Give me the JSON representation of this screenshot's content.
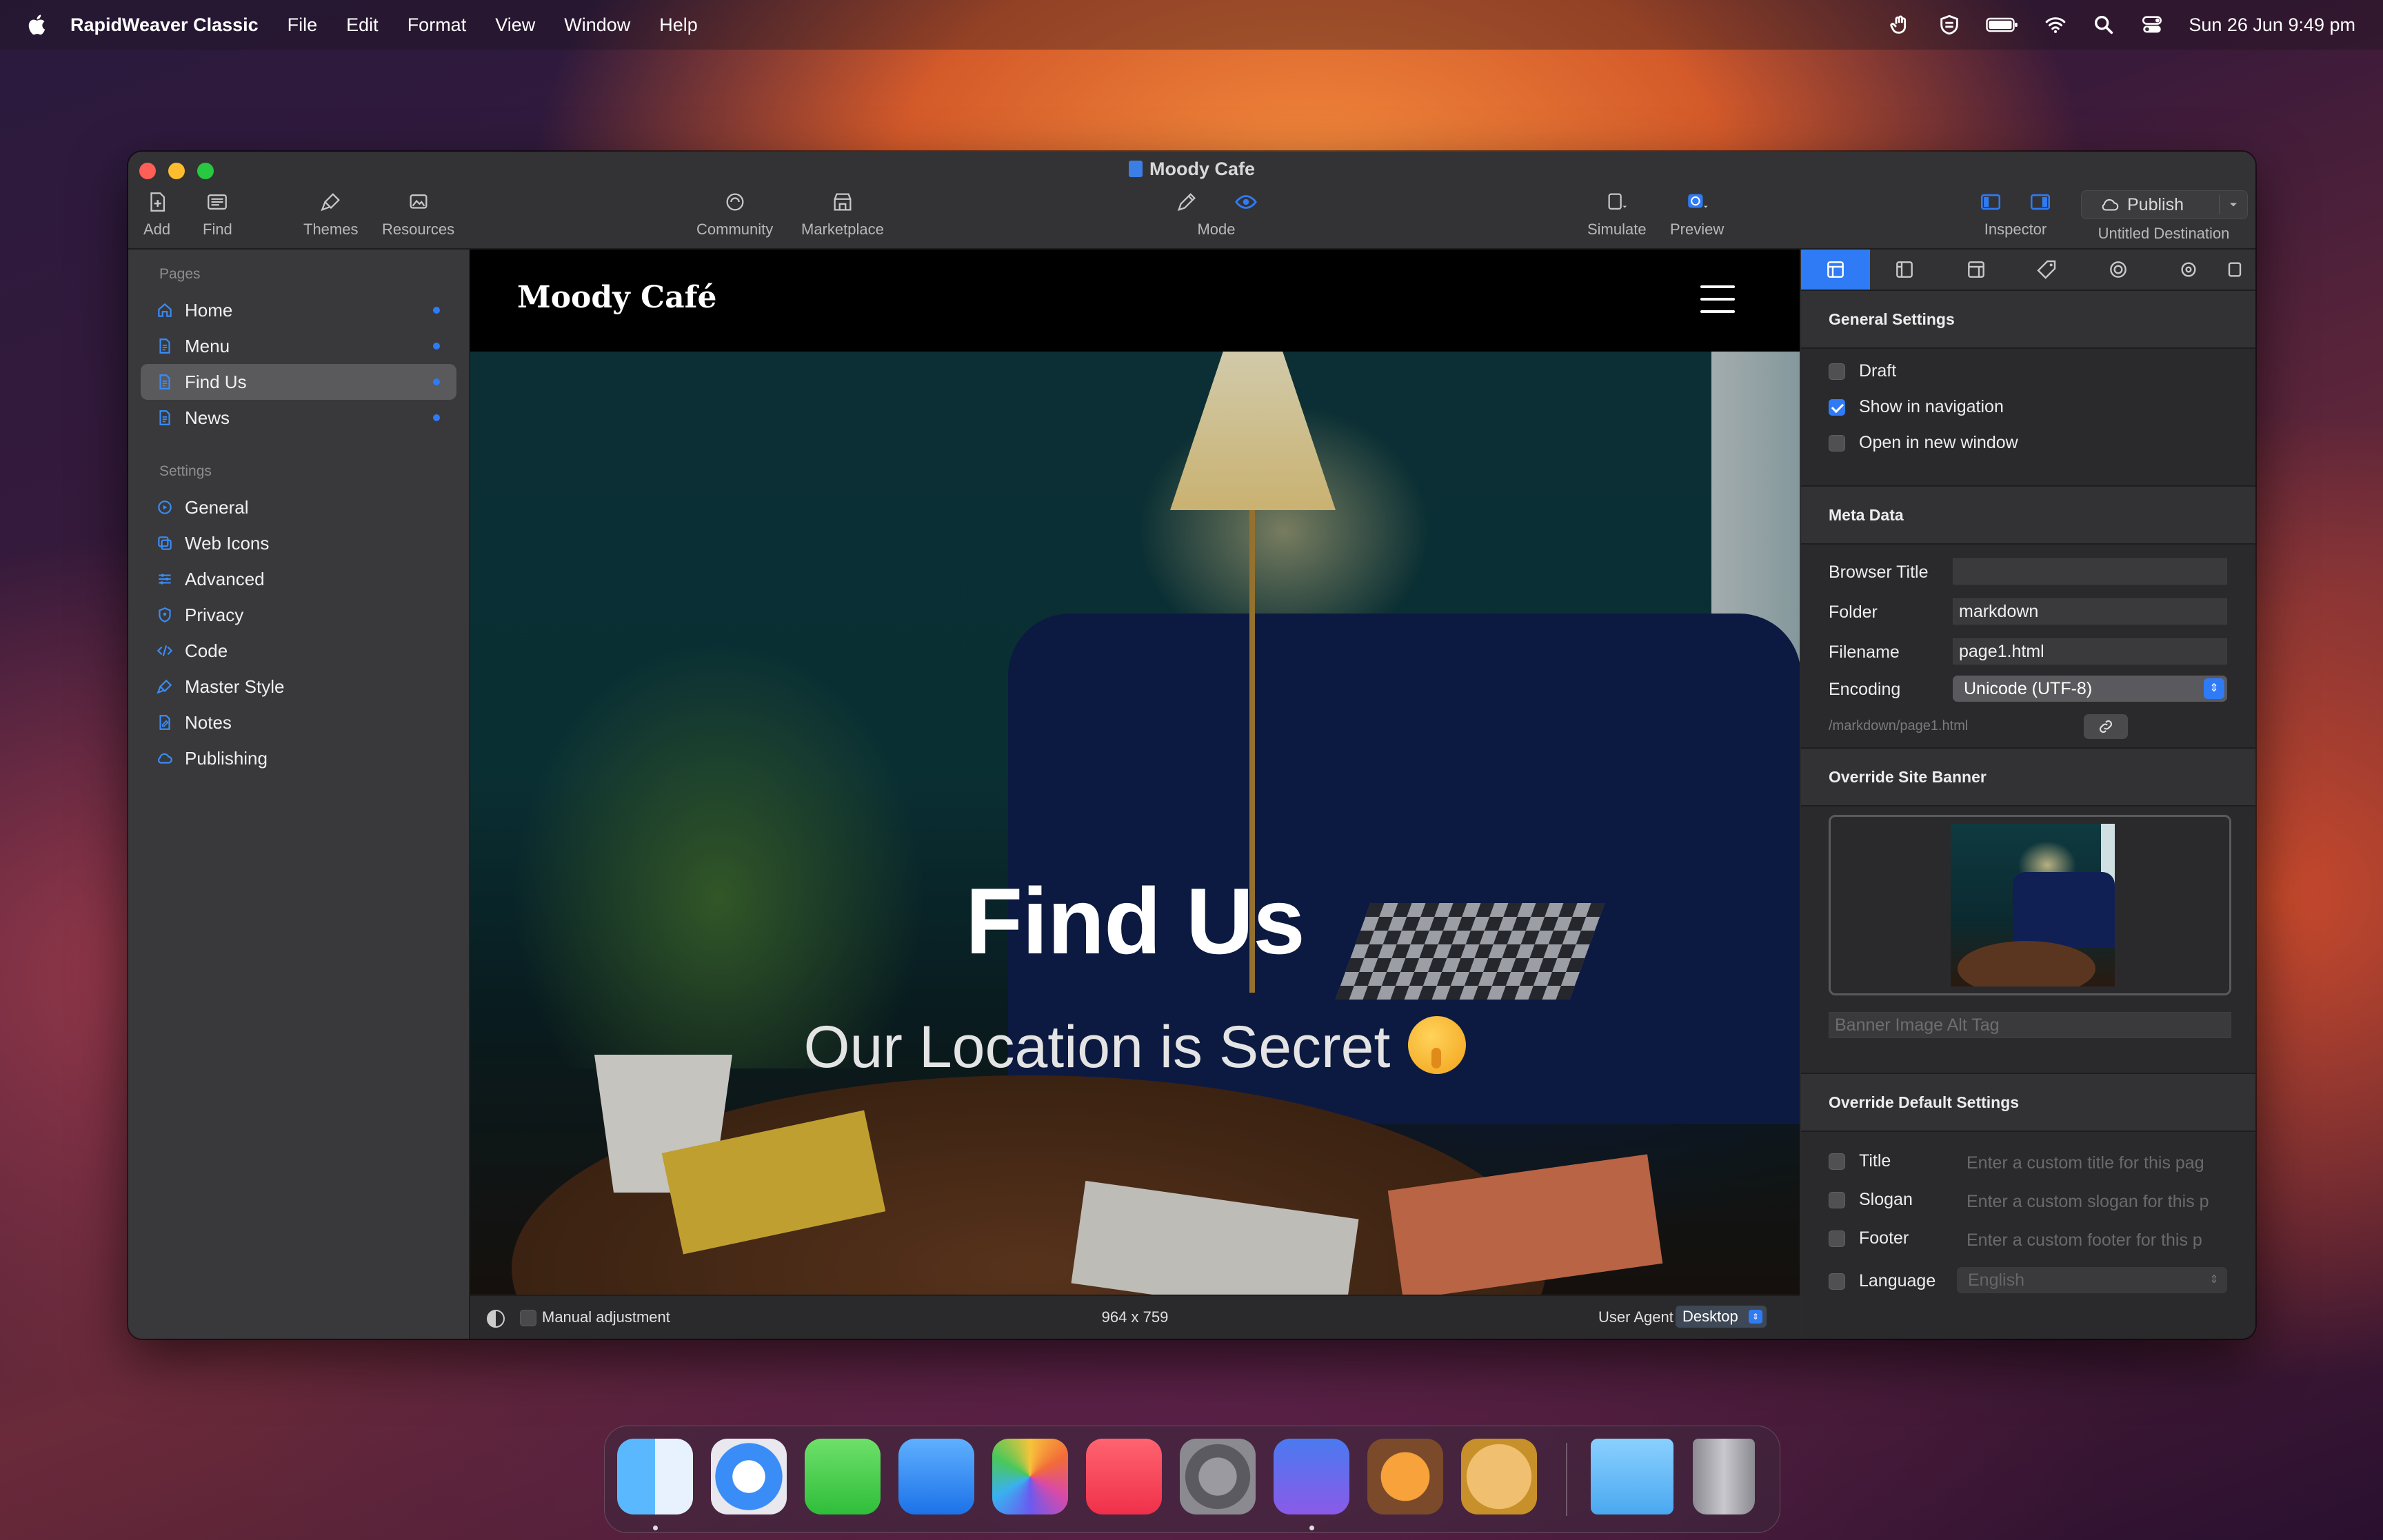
{
  "menubar": {
    "app_name": "RapidWeaver Classic",
    "items": [
      "File",
      "Edit",
      "Format",
      "View",
      "Window",
      "Help"
    ],
    "clock": "Sun 26 Jun  9:49 pm"
  },
  "window": {
    "title": "Moody Cafe",
    "toolbar": {
      "add": "Add",
      "find": "Find",
      "themes": "Themes",
      "resources": "Resources",
      "community": "Community",
      "marketplace": "Marketplace",
      "mode": "Mode",
      "simulate": "Simulate",
      "preview": "Preview",
      "inspector": "Inspector",
      "publish": "Publish",
      "destination": "Untitled Destination"
    }
  },
  "sidebar": {
    "pages_header": "Pages",
    "pages": [
      {
        "label": "Home"
      },
      {
        "label": "Menu"
      },
      {
        "label": "Find Us"
      },
      {
        "label": "News"
      }
    ],
    "selected_page": "Find Us",
    "settings_header": "Settings",
    "settings": [
      {
        "label": "General"
      },
      {
        "label": "Web Icons"
      },
      {
        "label": "Advanced"
      },
      {
        "label": "Privacy"
      },
      {
        "label": "Code"
      },
      {
        "label": "Master Style"
      },
      {
        "label": "Notes"
      },
      {
        "label": "Publishing"
      }
    ]
  },
  "preview": {
    "site_title": "Moody Café",
    "banner_title": "Find Us",
    "banner_subtitle": "Our Location is Secret",
    "status": {
      "manual_adjustment": "Manual adjustment",
      "dimensions": "964 x 759",
      "user_agent_label": "User Agent",
      "user_agent_value": "Desktop"
    }
  },
  "inspector": {
    "general": {
      "header": "General Settings",
      "draft": "Draft",
      "draft_checked": false,
      "show_in_navigation": "Show in navigation",
      "show_in_navigation_checked": true,
      "open_in_new_window": "Open in new window",
      "open_in_new_window_checked": false
    },
    "meta": {
      "header": "Meta Data",
      "browser_title_label": "Browser Title",
      "browser_title_value": "",
      "folder_label": "Folder",
      "folder_value": "markdown",
      "filename_label": "Filename",
      "filename_value": "page1.html",
      "encoding_label": "Encoding",
      "encoding_value": "Unicode (UTF-8)",
      "path": "/markdown/page1.html"
    },
    "banner": {
      "header": "Override Site Banner",
      "alt_placeholder": "Banner Image Alt Tag"
    },
    "overrides": {
      "header": "Override Default Settings",
      "title_label": "Title",
      "title_placeholder": "Enter a custom title for this pag",
      "slogan_label": "Slogan",
      "slogan_placeholder": "Enter a custom slogan for this p",
      "footer_label": "Footer",
      "footer_placeholder": "Enter a custom footer for this p",
      "language_label": "Language",
      "language_value": "English"
    }
  },
  "dock": {
    "apps": [
      "finder-icon",
      "safari-icon",
      "messages-icon",
      "mail-icon",
      "photos-icon",
      "music-icon",
      "system-settings-icon",
      "rapidweaver-icon",
      "orange-app-icon",
      "cat-app-icon",
      "downloads-folder-icon",
      "trash-icon"
    ]
  },
  "colors": {
    "accent": "#2f7bf6",
    "sidebar_bg": "#39393b",
    "inspector_bg": "#2a2a2c"
  }
}
